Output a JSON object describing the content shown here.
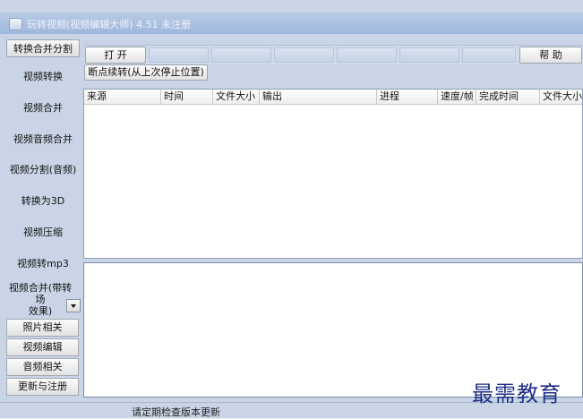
{
  "window": {
    "title": "玩转视频(视频编辑大师) 4.51 未注册"
  },
  "sidebar": {
    "top_tab": "转换合并分割",
    "items": [
      "视频转换",
      "视频合并",
      "视频音频合并",
      "视频分割(音频)",
      "转换为3D",
      "视频压缩",
      "视频转mp3"
    ],
    "merge_transition_line1": "视频合并(带转场",
    "merge_transition_line2": "效果)",
    "buttons": [
      "照片相关",
      "视频编辑",
      "音频相关",
      "更新与注册"
    ]
  },
  "toolbar": {
    "open_label": "打 开",
    "help_label": "帮 助",
    "resume_label": "断点续转(从上次停止位置)"
  },
  "table": {
    "columns": [
      "来源",
      "时间",
      "文件大小",
      "输出",
      "进程",
      "速度/帧",
      "完成时间",
      "文件大小"
    ]
  },
  "status": {
    "text": "请定期检查版本更新"
  },
  "watermark": "最需教育"
}
